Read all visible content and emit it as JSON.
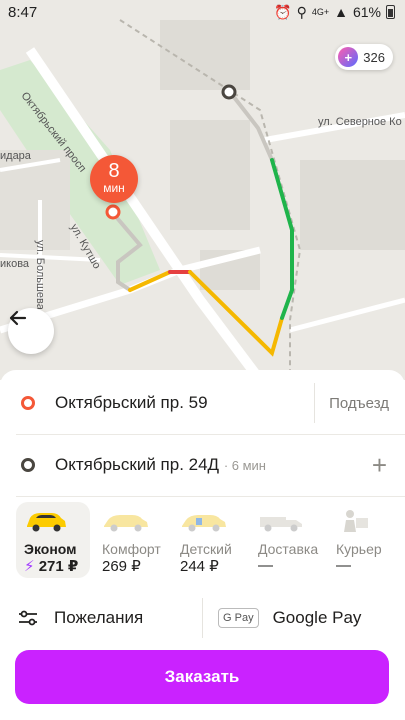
{
  "status_bar": {
    "time": "8:47",
    "network": "4G+",
    "battery": "61%"
  },
  "map": {
    "eta": {
      "value": "8",
      "unit": "мин"
    },
    "plus_points": "326",
    "labels": {
      "street1": "Октябрьский просп",
      "street2": "ул. Северное Ко",
      "street3": "ул. Кутшо",
      "street4": "ул. Большева",
      "street5": "идара",
      "street6": "икова"
    }
  },
  "route": {
    "from": "Октябрьский пр. 59",
    "from_action": "Подъезд",
    "to": "Октябрьский пр. 24Д",
    "to_eta": "· 6 мин",
    "add_stop": "+"
  },
  "tariffs": [
    {
      "name": "Эконом",
      "price": "271 ₽",
      "active": true,
      "surge_icon": "⚡"
    },
    {
      "name": "Комфорт",
      "price": "269 ₽",
      "active": false
    },
    {
      "name": "Детский",
      "price": "244 ₽",
      "active": false
    },
    {
      "name": "Доставка",
      "price": "—",
      "active": false
    },
    {
      "name": "Курьер",
      "price": "—",
      "active": false
    }
  ],
  "options": {
    "wishes": "Пожелания",
    "payment_badge": "G Pay",
    "payment": "Google Pay"
  },
  "order_button": "Заказать",
  "colors": {
    "accent": "#ca22ff",
    "from_dot": "#f45837",
    "route_slow": "#f5b800",
    "route_fast": "#1fb44b",
    "route_jam": "#e54040"
  }
}
